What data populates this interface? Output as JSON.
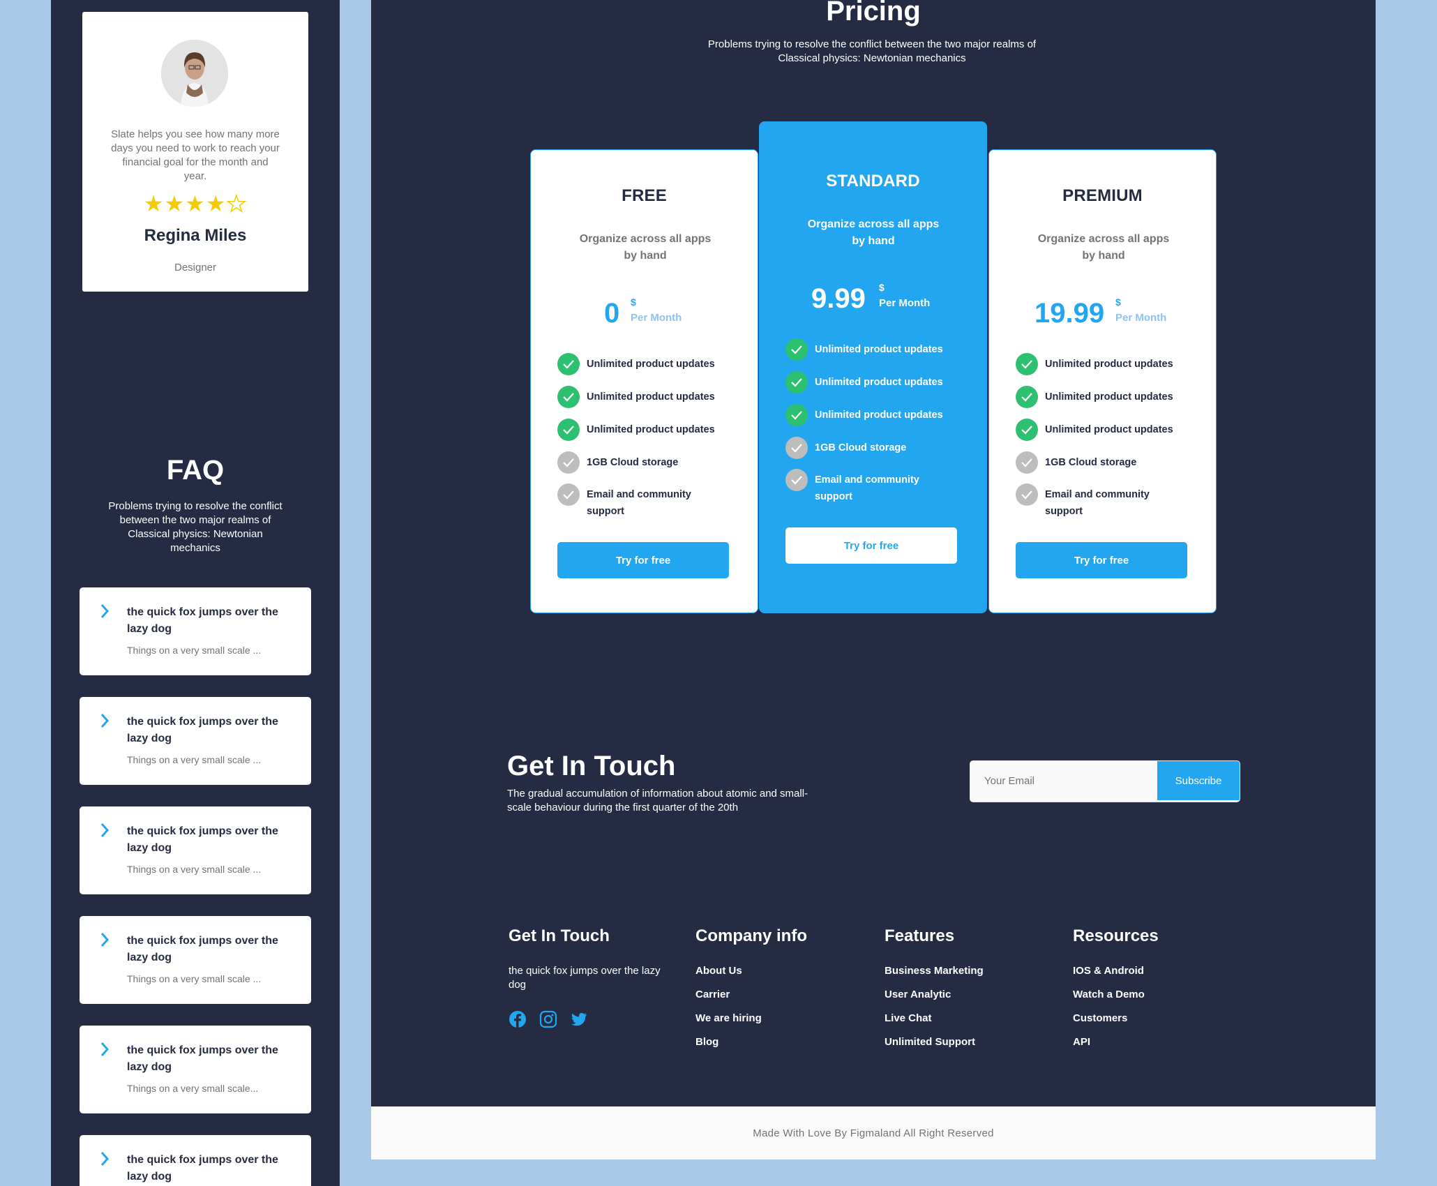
{
  "testimonial": {
    "quote": "Slate helps you see how many more days you need to work to reach your financial goal for the month and year.",
    "rating": 4,
    "rating_max": 5,
    "name": "Regina Miles",
    "role": "Designer"
  },
  "faq": {
    "title": "FAQ",
    "description": "Problems trying to resolve the conflict between the two major realms of Classical physics: Newtonian mechanics",
    "items": [
      {
        "question": "the quick fox jumps over the lazy dog",
        "answer": "Things on a very small scale ..."
      },
      {
        "question": "the quick fox jumps over the lazy dog",
        "answer": "Things on a very small scale ..."
      },
      {
        "question": "the quick fox jumps over the lazy dog",
        "answer": "Things on a very small scale ..."
      },
      {
        "question": "the quick fox jumps over the lazy dog",
        "answer": "Things on a very small scale ..."
      },
      {
        "question": "the quick fox jumps over the lazy dog",
        "answer": "Things on a very small scale..."
      },
      {
        "question": "the quick fox jumps over the lazy dog",
        "answer": ""
      }
    ]
  },
  "pricing": {
    "title": "Pricing",
    "description": "Problems trying to resolve the conflict between the two major realms of Classical physics: Newtonian mechanics",
    "plans": [
      {
        "name": "FREE",
        "subtitle": "Organize across all apps by hand",
        "price": "0",
        "currency": "$",
        "period": "Per Month",
        "features": [
          "Unlimited product updates",
          "Unlimited product updates",
          "Unlimited product updates",
          "1GB  Cloud storage",
          "Email and community support"
        ],
        "button": "Try for free"
      },
      {
        "name": "STANDARD",
        "subtitle": "Organize across all apps by hand",
        "price": "9.99",
        "currency": "$",
        "period": "Per Month",
        "features": [
          "Unlimited product updates",
          "Unlimited product updates",
          "Unlimited product updates",
          "1GB  Cloud storage",
          "Email and community support"
        ],
        "button": "Try for free"
      },
      {
        "name": "PREMIUM",
        "subtitle": "Organize across all apps by hand",
        "price": "19.99",
        "currency": "$",
        "period": "Per Month",
        "features": [
          "Unlimited product updates",
          "Unlimited product updates",
          "Unlimited product updates",
          "1GB  Cloud storage",
          "Email and community support"
        ],
        "button": "Try for free"
      }
    ]
  },
  "get_in_touch": {
    "title": "Get In Touch",
    "description": "The gradual accumulation of information about atomic and small-scale behaviour during the first quarter of the 20th",
    "email_placeholder": "Your Email",
    "subscribe_label": "Subscribe"
  },
  "footer": {
    "contact": {
      "title": "Get In Touch",
      "text": "the quick fox jumps over the lazy dog",
      "social_icons": [
        "facebook-icon",
        "instagram-icon",
        "twitter-icon"
      ]
    },
    "company": {
      "title": "Company info",
      "links": [
        "About Us",
        "Carrier",
        "We are hiring",
        "Blog"
      ]
    },
    "features": {
      "title": "Features",
      "links": [
        "Business Marketing",
        "User Analytic",
        "Live Chat",
        "Unlimited Support"
      ]
    },
    "resources": {
      "title": "Resources",
      "links": [
        "IOS & Android",
        "Watch a Demo",
        "Customers",
        "API"
      ]
    },
    "copyright": "Made With Love By Figmaland All Right Reserved"
  },
  "colors": {
    "primary": "#23a6f0",
    "dark": "#252b42",
    "success": "#2dc071",
    "muted": "#737373",
    "star": "#f3cd03",
    "page_bg": "#a9c8e8"
  }
}
